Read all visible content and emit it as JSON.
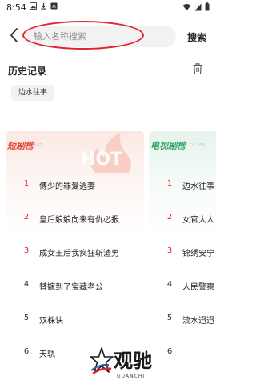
{
  "status_bar": {
    "time": "8:54"
  },
  "header": {
    "search_placeholder": "输入名称搜索",
    "search_button": "搜索"
  },
  "history": {
    "title": "历史记录",
    "tags": [
      "边水往事"
    ]
  },
  "short_drama": {
    "title": "短剧榜",
    "subtitle": "HOT",
    "items": [
      {
        "rank": "1",
        "title": "傅少的罪爱逃妻"
      },
      {
        "rank": "2",
        "title": "皇后娘娘向来有仇必报"
      },
      {
        "rank": "3",
        "title": "成女王后我疯狂斩渣男"
      },
      {
        "rank": "4",
        "title": "替嫁到了宝藏老公"
      },
      {
        "rank": "5",
        "title": "双株诀"
      },
      {
        "rank": "6",
        "title": "天轨"
      }
    ]
  },
  "tv_drama": {
    "title": "电视剧榜",
    "subtitle": "TV SER",
    "items": [
      {
        "rank": "1",
        "title": "边水往事"
      },
      {
        "rank": "2",
        "title": "女官大人"
      },
      {
        "rank": "3",
        "title": "锦绣安宁"
      },
      {
        "rank": "4",
        "title": "人民警察"
      },
      {
        "rank": "5",
        "title": "流水迢迢"
      },
      {
        "rank": "6",
        "title": ""
      }
    ]
  },
  "watermark": {
    "name": "观驰",
    "sub": "GUANCHI"
  },
  "colors": {
    "accent_red": "#e0242d",
    "short_title": "#e24a3b",
    "tv_title": "#3aa56b"
  }
}
